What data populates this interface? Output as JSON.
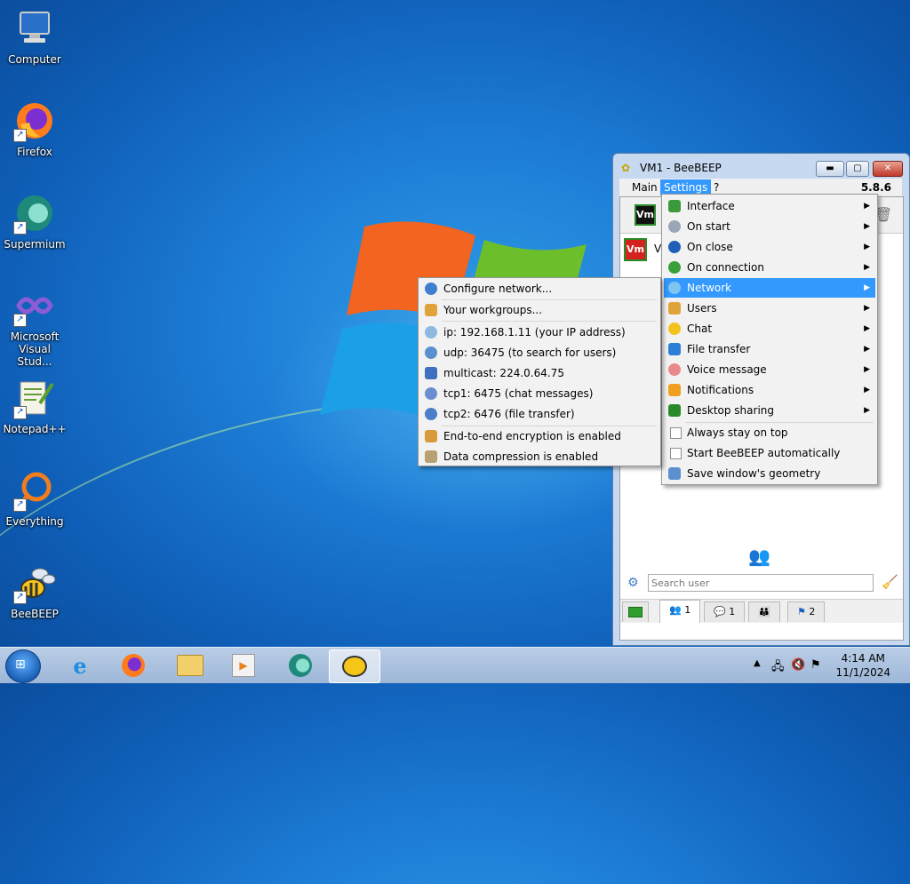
{
  "desktop": {
    "icons": [
      {
        "label": "Computer",
        "icon": "computer-icon"
      },
      {
        "label": "Firefox",
        "icon": "firefox-icon"
      },
      {
        "label": "Supermium",
        "icon": "supermium-icon"
      },
      {
        "label": "Microsoft Visual Stud...",
        "icon": "visual-studio-icon"
      },
      {
        "label": "Notepad++",
        "icon": "notepad-plus-plus-icon"
      },
      {
        "label": "Everything",
        "icon": "everything-icon"
      },
      {
        "label": "BeeBEEP",
        "icon": "beebeep-icon"
      }
    ]
  },
  "window": {
    "title": "VM1 - BeeBEEP",
    "version": "5.8.6",
    "menu": {
      "main": "Main",
      "settings": "Settings",
      "help": "?"
    },
    "avatar": "Vm",
    "user_initial": "V",
    "search_placeholder": "Search user",
    "tabs": [
      {
        "count": "1"
      },
      {
        "count": "1"
      },
      {
        "count": ""
      },
      {
        "count": "2"
      }
    ]
  },
  "settings_menu": [
    {
      "label": "Interface",
      "submenu": true
    },
    {
      "label": "On start",
      "submenu": true
    },
    {
      "label": "On close",
      "submenu": true
    },
    {
      "label": "On connection",
      "submenu": true
    },
    {
      "label": "Network",
      "submenu": true,
      "highlighted": true
    },
    {
      "label": "Users",
      "submenu": true
    },
    {
      "label": "Chat",
      "submenu": true
    },
    {
      "label": "File transfer",
      "submenu": true
    },
    {
      "label": "Voice message",
      "submenu": true
    },
    {
      "label": "Notifications",
      "submenu": true
    },
    {
      "label": "Desktop sharing",
      "submenu": true
    },
    {
      "label": "Always stay on top",
      "checkbox": true
    },
    {
      "label": "Start BeeBEEP automatically",
      "checkbox": true
    },
    {
      "label": "Save window's geometry"
    }
  ],
  "network_submenu": [
    {
      "label": "Configure network..."
    },
    {
      "label": "Your workgroups..."
    },
    {
      "label": "ip: 192.168.1.11 (your IP address)"
    },
    {
      "label": "udp: 36475 (to search for users)"
    },
    {
      "label": "multicast: 224.0.64.75"
    },
    {
      "label": "tcp1: 6475 (chat messages)"
    },
    {
      "label": "tcp2: 6476 (file transfer)"
    },
    {
      "label": "End-to-end encryption is enabled"
    },
    {
      "label": "Data compression is enabled"
    }
  ],
  "taskbar": {
    "clock_time": "4:14 AM",
    "clock_date": "11/1/2024"
  }
}
